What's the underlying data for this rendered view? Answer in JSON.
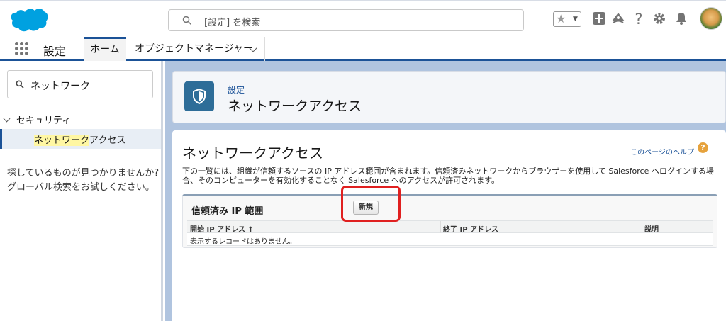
{
  "header": {
    "search_placeholder": "[設定] を検索",
    "icons": [
      "favorites-star-icon",
      "favorites-dropdown-icon",
      "global-actions-plus-icon",
      "trailhead-icon",
      "help-icon",
      "gear-icon",
      "notifications-bell-icon",
      "avatar"
    ]
  },
  "nav": {
    "app_name": "設定",
    "tabs": [
      {
        "label": "ホーム",
        "active": true
      },
      {
        "label": "オブジェクトマネージャー",
        "active": false
      }
    ]
  },
  "sidebar": {
    "quick_find_value": "ネットワーク",
    "section_label": "セキュリティ",
    "item_label_highlight": "ネットワーク",
    "item_label_rest": "アクセス",
    "not_found_line1": "探しているものが見つかりませんか?",
    "not_found_line2": "グローバル検索をお試しください。"
  },
  "page_header": {
    "subtitle": "設定",
    "title": "ネットワークアクセス"
  },
  "content": {
    "title": "ネットワークアクセス",
    "help_link": "このページのヘルプ",
    "description": "下の一覧には、組織が信頼するソースの IP アドレス範囲が含まれます。信頼済みネットワークからブラウザーを使用して Salesforce へログインする場合、そのコンピューターを有効化することなく Salesforce へのアクセスが許可されます。",
    "list": {
      "title": "信頼済み IP 範囲",
      "new_button": "新規",
      "columns": [
        "開始 IP アドレス ↑",
        "終了 IP アドレス",
        "説明"
      ],
      "empty_message": "表示するレコードはありません。"
    }
  },
  "colors": {
    "brand_blue": "#1b5297",
    "sidebar_highlight": "#fff7a3",
    "annotation_red": "#e02020",
    "page_background": "#b0c4df"
  }
}
